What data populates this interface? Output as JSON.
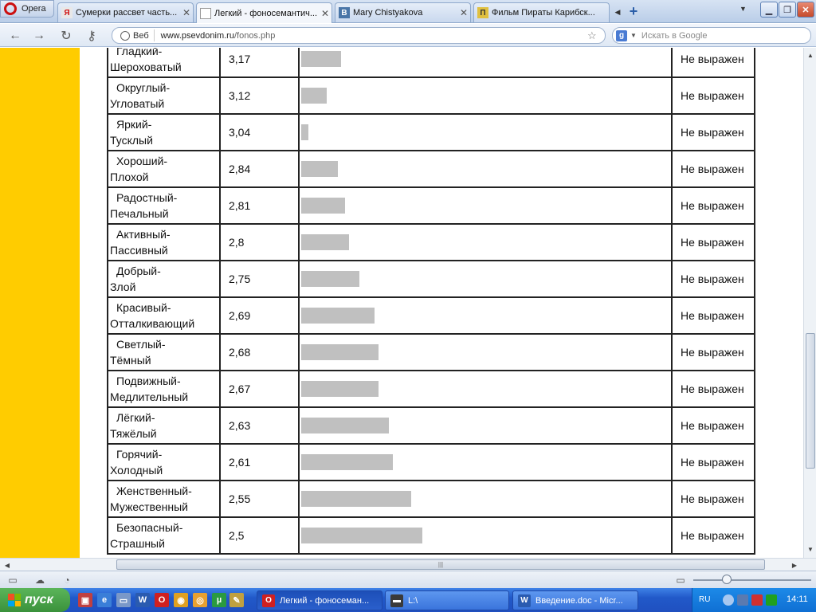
{
  "browser": {
    "menu_label": "Opera",
    "tabs": [
      {
        "label": "Сумерки рассвет часть...",
        "favicon": "Я",
        "active": false
      },
      {
        "label": "Легкий - фоносемантич...",
        "favicon": "",
        "active": true
      },
      {
        "label": "Mary Chistyakova",
        "favicon": "В",
        "active": false
      },
      {
        "label": "Фильм Пираты Карибск...",
        "favicon": "П",
        "active": false
      }
    ],
    "address": {
      "badge": "Веб",
      "domain": "www.psevdonim.ru",
      "path": "/fonos.php"
    },
    "search_placeholder": "Искать в Google"
  },
  "table": {
    "rows": [
      {
        "word1": "Гладкий-",
        "word2": "Шероховатый",
        "value": "3,17",
        "bar": 50,
        "evaluation": "Не выражен"
      },
      {
        "word1": "Округлый-",
        "word2": "Угловатый",
        "value": "3,12",
        "bar": 32,
        "evaluation": "Не выражен"
      },
      {
        "word1": "Яркий-",
        "word2": "Тусклый",
        "value": "3,04",
        "bar": 9,
        "evaluation": "Не выражен"
      },
      {
        "word1": "Хороший-",
        "word2": "Плохой",
        "value": "2,84",
        "bar": 46,
        "evaluation": "Не выражен"
      },
      {
        "word1": "Радостный-",
        "word2": "Печальный",
        "value": "2,81",
        "bar": 55,
        "evaluation": "Не выражен"
      },
      {
        "word1": "Активный-",
        "word2": "Пассивный",
        "value": "2,8",
        "bar": 60,
        "evaluation": "Не выражен"
      },
      {
        "word1": "Добрый-",
        "word2": "Злой",
        "value": "2,75",
        "bar": 73,
        "evaluation": "Не выражен"
      },
      {
        "word1": "Красивый-",
        "word2": "Отталкивающий",
        "value": "2,69",
        "bar": 92,
        "evaluation": "Не выражен"
      },
      {
        "word1": "Светлый-",
        "word2": "Тёмный",
        "value": "2,68",
        "bar": 97,
        "evaluation": "Не выражен"
      },
      {
        "word1": "Подвижный-",
        "word2": "Медлительный",
        "value": "2,67",
        "bar": 97,
        "evaluation": "Не выражен"
      },
      {
        "word1": "Лёгкий-",
        "word2": "Тяжёлый",
        "value": "2,63",
        "bar": 110,
        "evaluation": "Не выражен"
      },
      {
        "word1": "Горячий-",
        "word2": "Холодный",
        "value": "2,61",
        "bar": 115,
        "evaluation": "Не выражен"
      },
      {
        "word1": "Женственный-",
        "word2": "Мужественный",
        "value": "2,55",
        "bar": 138,
        "evaluation": "Не выражен"
      },
      {
        "word1": "Безопасный-",
        "word2": "Страшный",
        "value": "2,5",
        "bar": 152,
        "evaluation": "Не выражен"
      }
    ]
  },
  "taskbar": {
    "start_label": "пуск",
    "tasks": [
      {
        "label": "Легкий - фоносеман...",
        "active": true
      },
      {
        "label": "L:\\",
        "active": false
      },
      {
        "label": "Введение.doc - Micr...",
        "active": false
      }
    ],
    "lang": "RU",
    "clock": "14:11"
  },
  "colors": {
    "page_band": "#ffcc00",
    "bar_fill": "#c0c0c0",
    "taskbar": "#2459c9",
    "start": "#3a913b"
  }
}
